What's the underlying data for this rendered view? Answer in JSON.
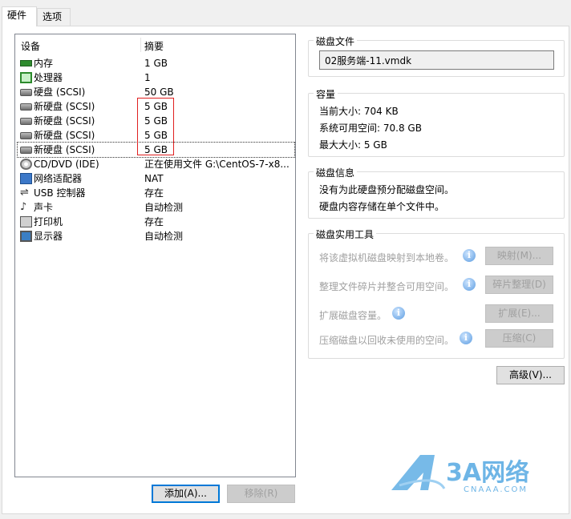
{
  "tabs": [
    {
      "label": "硬件"
    },
    {
      "label": "选项"
    }
  ],
  "device_list": {
    "headers": {
      "device": "设备",
      "summary": "摘要"
    },
    "rows": [
      {
        "icon": "memory-icon",
        "name": "内存",
        "summary": "1 GB"
      },
      {
        "icon": "processor-icon",
        "name": "处理器",
        "summary": "1"
      },
      {
        "icon": "hard-disk-icon",
        "name": "硬盘 (SCSI)",
        "summary": "50 GB"
      },
      {
        "icon": "hard-disk-icon",
        "name": "新硬盘 (SCSI)",
        "summary": "5 GB"
      },
      {
        "icon": "hard-disk-icon",
        "name": "新硬盘 (SCSI)",
        "summary": "5 GB"
      },
      {
        "icon": "hard-disk-icon",
        "name": "新硬盘 (SCSI)",
        "summary": "5 GB"
      },
      {
        "icon": "hard-disk-icon",
        "name": "新硬盘 (SCSI)",
        "summary": "5 GB"
      },
      {
        "icon": "cd-dvd-icon",
        "name": "CD/DVD (IDE)",
        "summary": "正在使用文件 G:\\CentOS-7-x8..."
      },
      {
        "icon": "network-adapter-icon",
        "name": "网络适配器",
        "summary": "NAT"
      },
      {
        "icon": "usb-controller-icon",
        "name": "USB 控制器",
        "summary": "存在"
      },
      {
        "icon": "sound-card-icon",
        "name": "声卡",
        "summary": "自动检测"
      },
      {
        "icon": "printer-icon",
        "name": "打印机",
        "summary": "存在"
      },
      {
        "icon": "display-icon",
        "name": "显示器",
        "summary": "自动检测"
      }
    ]
  },
  "buttons": {
    "add": "添加(A)...",
    "remove": "移除(R)",
    "advanced": "高级(V)..."
  },
  "disk_file": {
    "title": "磁盘文件",
    "value": "02服务端-11.vmdk"
  },
  "capacity": {
    "title": "容量",
    "current_size": "当前大小: 704 KB",
    "available_space": "系统可用空间: 70.8 GB",
    "max_size": "最大大小: 5 GB"
  },
  "disk_info": {
    "title": "磁盘信息",
    "line1": "没有为此硬盘预分配磁盘空间。",
    "line2": "硬盘内容存储在单个文件中。"
  },
  "disk_utilities": {
    "title": "磁盘实用工具",
    "map_text": "将该虚拟机磁盘映射到本地卷。",
    "map_button": "映射(M)...",
    "defrag_text": "整理文件碎片并整合可用空间。",
    "defrag_button": "碎片整理(D)",
    "expand_text": "扩展磁盘容量。",
    "expand_button": "扩展(E)...",
    "compact_text": "压缩磁盘以回收未使用的空间。",
    "compact_button": "压缩(C)"
  },
  "watermark": {
    "logo": "3A网络",
    "domain": "CNAAA.COM"
  },
  "colors": {
    "highlight_box": "#e02020",
    "focus_border": "#0078d7",
    "info_icon": "#5a9be0",
    "watermark": "#4aa3e0"
  }
}
